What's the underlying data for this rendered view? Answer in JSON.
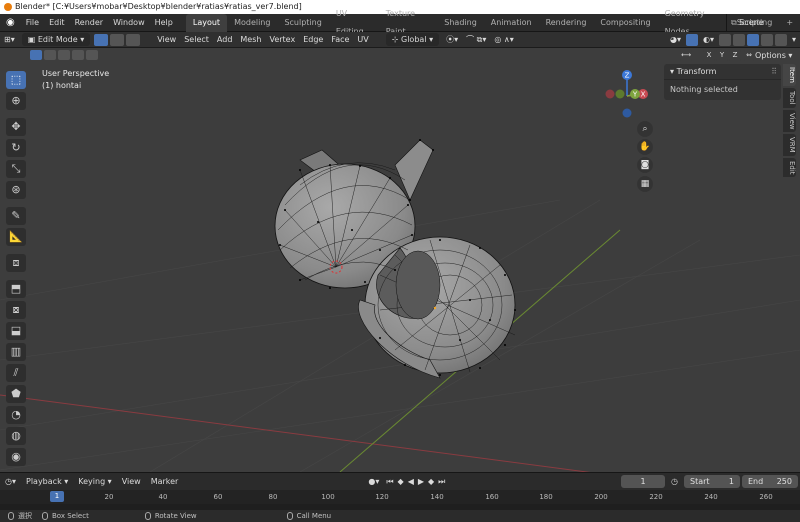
{
  "window": {
    "title": "Blender* [C:¥Users¥mobar¥Desktop¥blender¥ratias¥ratias_ver7.blend]"
  },
  "menu": [
    "File",
    "Edit",
    "Render",
    "Window",
    "Help"
  ],
  "workspaces": [
    "Layout",
    "Modeling",
    "Sculpting",
    "UV Editing",
    "Texture Paint",
    "Shading",
    "Animation",
    "Rendering",
    "Compositing",
    "Geometry Nodes",
    "Scripting",
    "+"
  ],
  "scene": "Scene",
  "header": {
    "mode": "Edit Mode",
    "menus": [
      "View",
      "Select",
      "Add",
      "Mesh",
      "Vertex",
      "Edge",
      "Face",
      "UV"
    ],
    "orientation": "Global",
    "options": "Options"
  },
  "mirror_axes": [
    "X",
    "Y",
    "Z"
  ],
  "viewport": {
    "perspective": "User Perspective",
    "object": "(1) hontai",
    "gizmo_axes": {
      "z": "Z",
      "y": "Y",
      "x": "X"
    }
  },
  "tools": [
    "select",
    "cursor",
    "move",
    "rotate",
    "scale",
    "transform",
    "annotate",
    "measure",
    "add-cube",
    "extrude",
    "inset",
    "bevel",
    "loop-cut",
    "knife",
    "poly-build",
    "spin",
    "smooth",
    "shrink-fatten",
    "shear"
  ],
  "npanel": {
    "title": "Transform",
    "body": "Nothing selected",
    "tabs": [
      "Item",
      "Tool",
      "View",
      "VRM",
      "Edit"
    ]
  },
  "timeline": {
    "menus": [
      "Playback",
      "Keying",
      "View",
      "Marker"
    ],
    "current_frame": "1",
    "start_label": "Start",
    "start": "1",
    "end_label": "End",
    "end": "250",
    "ruler_frame": "1",
    "ticks": [
      "20",
      "40",
      "60",
      "80",
      "100",
      "120",
      "140",
      "160",
      "180",
      "200",
      "220",
      "240",
      "260"
    ]
  },
  "status": {
    "select": "選択",
    "box_select": "Box Select",
    "rotate_view": "Rotate View",
    "call_menu": "Call Menu"
  },
  "colors": {
    "accent": "#4772b3",
    "x_axis": "#c84a52",
    "y_axis": "#7ea33e",
    "z_axis": "#3c78d8"
  }
}
